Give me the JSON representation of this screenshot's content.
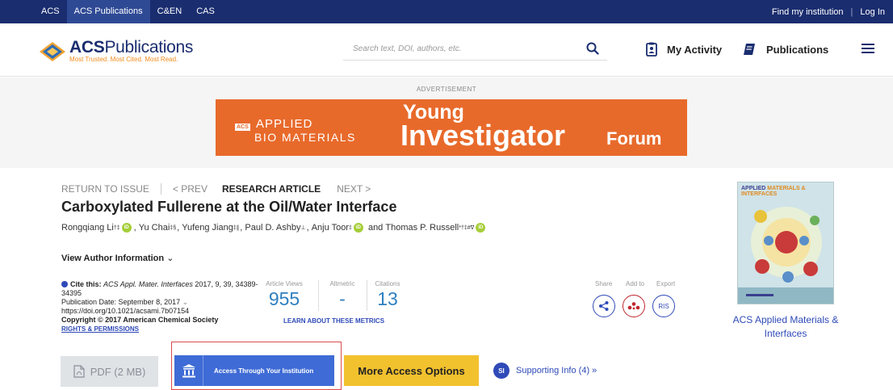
{
  "topbar": {
    "links": [
      "ACS",
      "ACS Publications",
      "C&EN",
      "CAS"
    ],
    "active_index": 1,
    "find_institution": "Find my institution",
    "separator": "|",
    "login": "Log In"
  },
  "header": {
    "logo_brand": "ACS Publications",
    "logo_tagline": "Most Trusted. Most Cited. Most Read.",
    "search_placeholder": "Search text, DOI, authors, etc.",
    "my_activity": "My Activity",
    "publications": "Publications"
  },
  "ad": {
    "label": "ADVERTISEMENT",
    "acs": "ACS",
    "applied": "APPLIED",
    "bio": "BIO MATERIALS",
    "young": "Young",
    "investigator": "Investigator",
    "forum": "Forum"
  },
  "article_nav": {
    "return": "RETURN TO ISSUE",
    "prev": "< PREV",
    "type": "RESEARCH ARTICLE",
    "next": "NEXT >"
  },
  "article": {
    "title": "Carboxylated Fullerene at the Oil/Water Interface",
    "authors": [
      {
        "name": "Rongqiang Li",
        "sup": "†‡",
        "orcid": true
      },
      {
        "name": "Yu Chai",
        "sup": "‡§",
        "orcid": false
      },
      {
        "name": "Yufeng Jiang",
        "sup": "‡∥",
        "orcid": false
      },
      {
        "name": "Paul D. Ashby",
        "sup": "⊥",
        "orcid": false
      },
      {
        "name": "Anju Toor",
        "sup": "‡",
        "orcid": true
      },
      {
        "name": "Thomas P. Russell",
        "sup": "*†‡#∇",
        "orcid": true
      }
    ],
    "view_author_info": "View Author Information",
    "cite_label": "Cite this:",
    "cite_journal": "ACS Appl. Mater. Interfaces",
    "cite_rest": " 2017, 9, 39, 34389-34395",
    "pub_date": "Publication Date: September 8, 2017",
    "doi": "https://doi.org/10.1021/acsami.7b07154",
    "copyright": "Copyright © 2017 American Chemical Society",
    "rights": "RIGHTS & PERMISSIONS"
  },
  "metrics": {
    "views_label": "Article Views",
    "views": "955",
    "altmetric_label": "Altmetric",
    "altmetric": "-",
    "citations_label": "Citations",
    "citations": "13",
    "learn": "LEARN ABOUT THESE METRICS"
  },
  "actions": {
    "share": "Share",
    "add_to": "Add to",
    "export": "Export",
    "ris": "RIS"
  },
  "journal": {
    "cover_title_a": "APPLIED",
    "cover_title_b": "MATERIALS & INTERFACES",
    "name": "ACS Applied Materials & Interfaces"
  },
  "buttons": {
    "pdf": "PDF (2 MB)",
    "institution": "Access Through Your Institution",
    "more": "More Access Options",
    "supporting": "Supporting Info (4) »",
    "si": "SI"
  },
  "colors": {
    "navy": "#1a2d6f",
    "accent_blue": "#2f4ab8",
    "banner_orange": "#e86a2b",
    "more_yellow": "#f2c12e",
    "orcid_green": "#a6ce39"
  }
}
